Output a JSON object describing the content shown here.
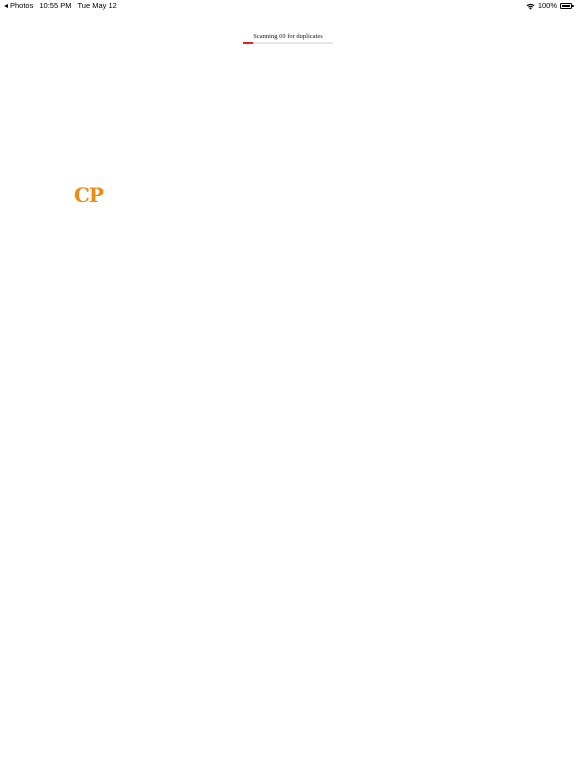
{
  "status_bar": {
    "back_label": "Photos",
    "time": "10:55 PM",
    "date": "Tue May 12",
    "battery_percent": "100%",
    "icons": [
      "back-arrow-icon",
      "wifi-icon",
      "battery-icon"
    ]
  },
  "scan": {
    "label": "Scanning 69 for duplicates",
    "progress_fraction": 0.11,
    "progress_color": "#e52222"
  },
  "logo": {
    "text": "CP",
    "color": "#f08a10"
  }
}
